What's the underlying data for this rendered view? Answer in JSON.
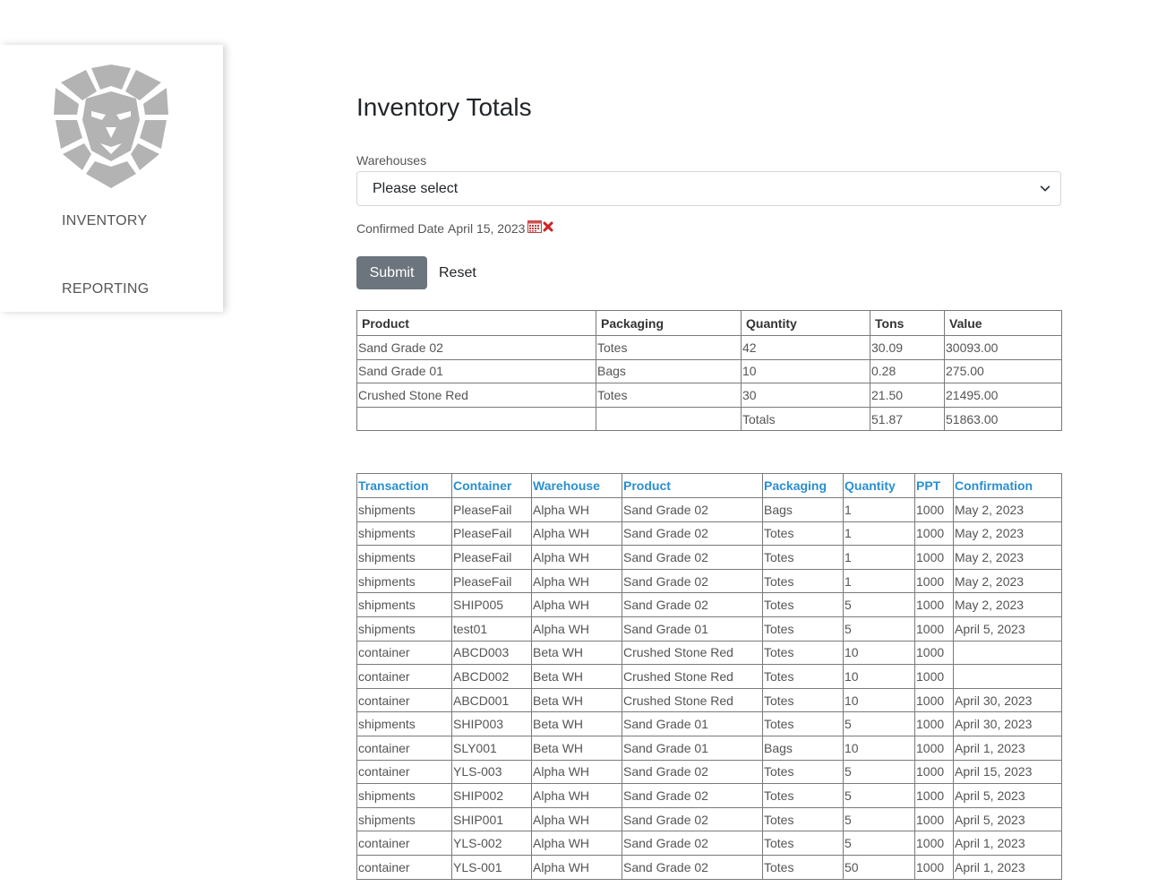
{
  "sidebar": {
    "logo_icon": "lion-head-icon",
    "items": [
      {
        "label": "INVENTORY"
      },
      {
        "label": "REPORTING"
      }
    ]
  },
  "page": {
    "title": "Inventory Totals"
  },
  "filters": {
    "warehouses_label": "Warehouses",
    "warehouses_selected": "Please select",
    "date_label": "Confirmed Date",
    "date_value": "April 15, 2023",
    "submit_label": "Submit",
    "reset_label": "Reset"
  },
  "totals_table": {
    "headers": [
      "Product",
      "Packaging",
      "Quantity",
      "Tons",
      "Value"
    ],
    "rows": [
      [
        "Sand Grade 02",
        "Totes",
        "42",
        "30.09",
        "30093.00"
      ],
      [
        "Sand Grade 01",
        "Bags",
        "10",
        "0.28",
        "275.00"
      ],
      [
        "Crushed Stone Red",
        "Totes",
        "30",
        "21.50",
        "21495.00"
      ],
      [
        "",
        "",
        "Totals",
        "51.87",
        "51863.00"
      ]
    ]
  },
  "transactions_table": {
    "headers": [
      "Transaction",
      "Container",
      "Warehouse",
      "Product",
      "Packaging",
      "Quantity",
      "PPT",
      "Confirmation"
    ],
    "rows": [
      [
        "shipments",
        "PleaseFail",
        "Alpha WH",
        "Sand Grade 02",
        "Bags",
        "1",
        "1000",
        "May 2, 2023"
      ],
      [
        "shipments",
        "PleaseFail",
        "Alpha WH",
        "Sand Grade 02",
        "Totes",
        "1",
        "1000",
        "May 2, 2023"
      ],
      [
        "shipments",
        "PleaseFail",
        "Alpha WH",
        "Sand Grade 02",
        "Totes",
        "1",
        "1000",
        "May 2, 2023"
      ],
      [
        "shipments",
        "PleaseFail",
        "Alpha WH",
        "Sand Grade 02",
        "Totes",
        "1",
        "1000",
        "May 2, 2023"
      ],
      [
        "shipments",
        "SHIP005",
        "Alpha WH",
        "Sand Grade 02",
        "Totes",
        "5",
        "1000",
        "May 2, 2023"
      ],
      [
        "shipments",
        "test01",
        "Alpha WH",
        "Sand Grade 01",
        "Totes",
        "5",
        "1000",
        "April 5, 2023"
      ],
      [
        "container",
        "ABCD003",
        "Beta WH",
        "Crushed Stone Red",
        "Totes",
        "10",
        "1000",
        ""
      ],
      [
        "container",
        "ABCD002",
        "Beta WH",
        "Crushed Stone Red",
        "Totes",
        "10",
        "1000",
        ""
      ],
      [
        "container",
        "ABCD001",
        "Beta WH",
        "Crushed Stone Red",
        "Totes",
        "10",
        "1000",
        "April 30, 2023"
      ],
      [
        "shipments",
        "SHIP003",
        "Beta WH",
        "Sand Grade 01",
        "Totes",
        "5",
        "1000",
        "April 30, 2023"
      ],
      [
        "container",
        "SLY001",
        "Beta WH",
        "Sand Grade 01",
        "Bags",
        "10",
        "1000",
        "April 1, 2023"
      ],
      [
        "container",
        "YLS-003",
        "Alpha WH",
        "Sand Grade 02",
        "Totes",
        "5",
        "1000",
        "April 15, 2023"
      ],
      [
        "shipments",
        "SHIP002",
        "Alpha WH",
        "Sand Grade 02",
        "Totes",
        "5",
        "1000",
        "April 5, 2023"
      ],
      [
        "shipments",
        "SHIP001",
        "Alpha WH",
        "Sand Grade 02",
        "Totes",
        "5",
        "1000",
        "April 5, 2023"
      ],
      [
        "container",
        "YLS-002",
        "Alpha WH",
        "Sand Grade 02",
        "Totes",
        "5",
        "1000",
        "April 1, 2023"
      ],
      [
        "container",
        "YLS-001",
        "Alpha WH",
        "Sand Grade 02",
        "Totes",
        "50",
        "1000",
        "April 1, 2023"
      ]
    ]
  },
  "colors": {
    "sidebar_bg": "#ffffff",
    "logo_gray": "#b3b3b3",
    "submit_bg": "#6c757d",
    "link_blue": "#2a8fd0",
    "clear_red": "#cc2222"
  }
}
